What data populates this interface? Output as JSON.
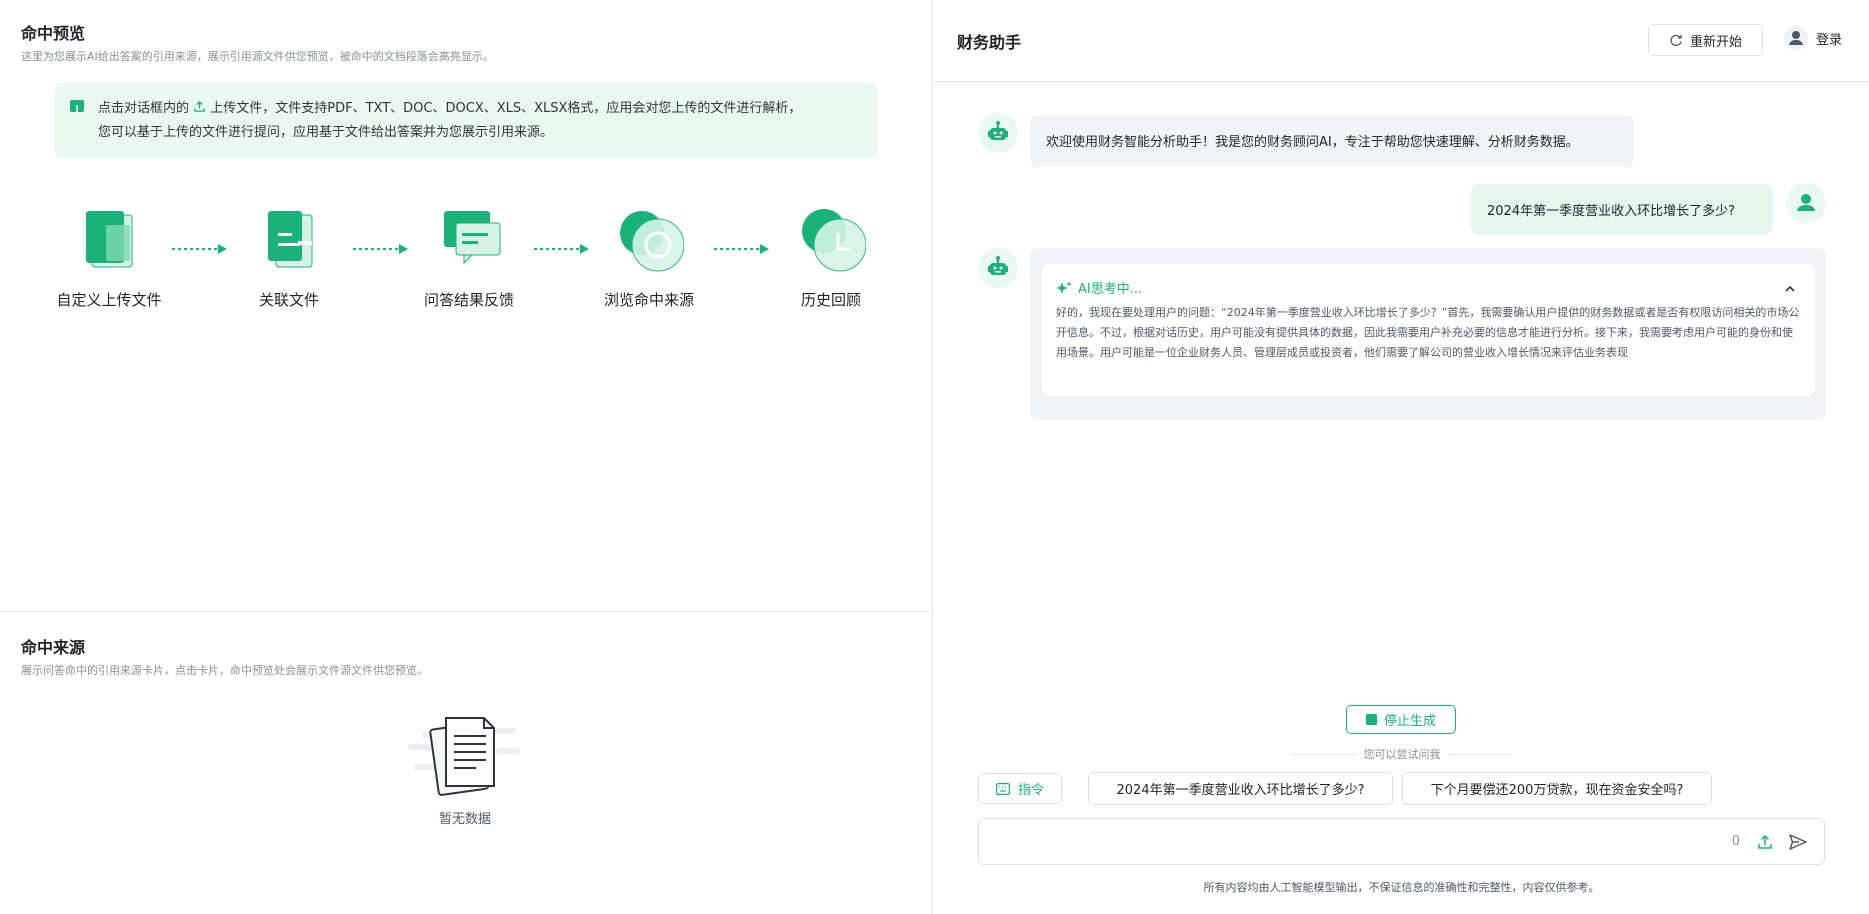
{
  "preview": {
    "title": "命中预览",
    "subtitle": "这里为您展示AI给出答案的引用来源，展示引用源文件供您预览，被命中的文档段落会高亮显示。",
    "tip_line1_prefix": "点击对话框内的",
    "tip_line1_suffix": "上传文件，文件支持PDF、TXT、DOC、DOCX、XLS、XLSX格式，应用会对您上传的文件进行解析，",
    "tip_line2": "您可以基于上传的文件进行提问，应用基于文件给出答案并为您展示引用来源。",
    "steps": [
      {
        "label": "自定义上传文件",
        "icon": "upload-file-icon"
      },
      {
        "label": "关联文件",
        "icon": "link-file-icon"
      },
      {
        "label": "问答结果反馈",
        "icon": "feedback-icon"
      },
      {
        "label": "浏览命中来源",
        "icon": "browse-source-icon"
      },
      {
        "label": "历史回顾",
        "icon": "history-icon"
      }
    ]
  },
  "sources": {
    "title": "命中来源",
    "subtitle": "展示问答命中的引用来源卡片，点击卡片，命中预览处会展示文件源文件供您预览。",
    "empty_text": "暂无数据"
  },
  "assistant": {
    "title": "财务助手",
    "restart_label": "重新开始",
    "login_label": "登录",
    "welcome": "欢迎使用财务智能分析助手！我是您的财务顾问AI，专注于帮助您快速理解、分析财务数据。",
    "user_question": "2024年第一季度营业收入环比增长了多少?",
    "thinking_title": "AI思考中...",
    "thinking_text": "好的，我现在要处理用户的问题：“2024年第一季度营业收入环比增长了多少？”首先，我需要确认用户提供的财务数据或者是否有权限访问相关的市场公开信息。不过，根据对话历史，用户可能没有提供具体的数据，因此我需要用户补充必要的信息才能进行分析。接下来，我需要考虑用户可能的身份和使用场景。用户可能是一位企业财务人员、管理层成员或投资者，他们需要了解公司的营业收入增长情况来评估业务表现",
    "stop_label": "停止生成",
    "try_label": "您可以尝试问我",
    "command_label": "指令",
    "suggestions": [
      "2024年第一季度营业收入环比增长了多少?",
      "下个月要偿还200万贷款，现在资金安全吗?"
    ],
    "input_count": "0",
    "disclaimer": "所有内容均由人工智能模型输出，不保证信息的准确性和完整性，内容仅供参考。"
  },
  "colors": {
    "accent": "#19b37a",
    "accent_light": "#e9f8f1"
  }
}
